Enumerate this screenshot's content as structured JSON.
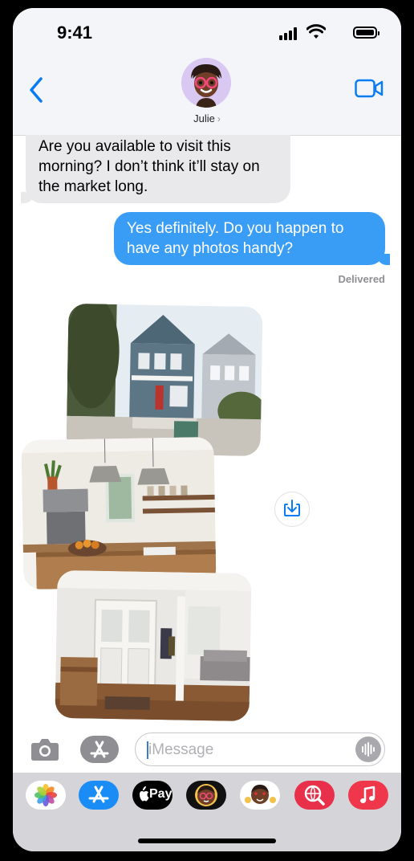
{
  "status": {
    "time": "9:41"
  },
  "header": {
    "contact_name": "Julie",
    "contact_chevron": "›"
  },
  "messages": {
    "incoming_text": "Are you available to visit this morning? I don’t think it’ll stay on the market long.",
    "outgoing_text": "Yes definitely. Do you happen to have any photos handy?",
    "delivered_label": "Delivered"
  },
  "photos": [
    {
      "subject": "house exterior"
    },
    {
      "subject": "kitchen"
    },
    {
      "subject": "entryway hallway"
    }
  ],
  "composer": {
    "placeholder": "iMessage"
  },
  "app_drawer": {
    "apple_pay_label": "Pay",
    "apps": [
      "photos-icon",
      "app-store-icon",
      "apple-pay-icon",
      "memoji-icon",
      "memoji-stickers-icon",
      "web-search-icon",
      "music-icon"
    ]
  },
  "colors": {
    "outgoing_bubble": "#3a9df5",
    "incoming_bubble": "#e9e9eb",
    "accent": "#0a7cf3"
  }
}
